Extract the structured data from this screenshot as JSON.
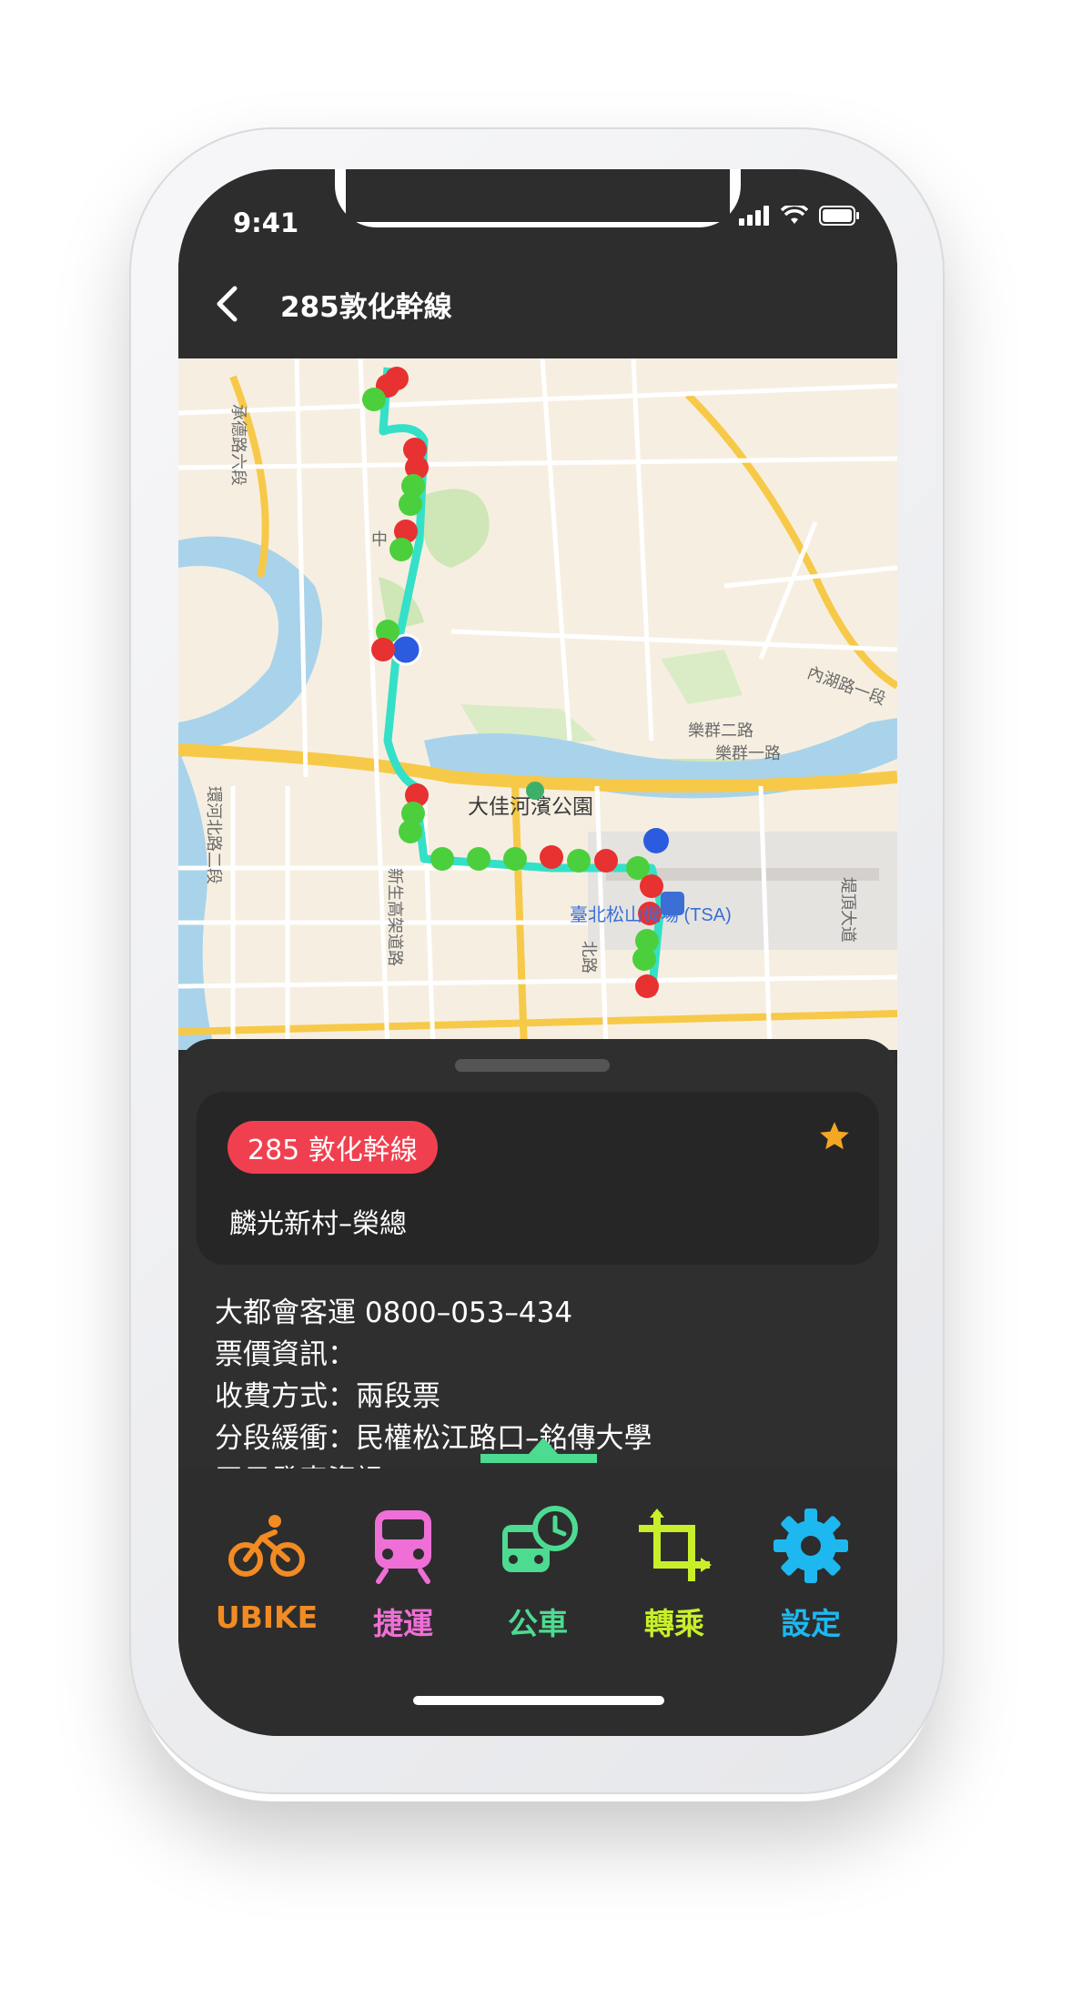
{
  "status_bar": {
    "time": "9:41"
  },
  "nav": {
    "title": "285敦化幹線",
    "back_icon": "chevron-left-icon"
  },
  "map": {
    "labels": {
      "road_chengde": "承德路六段",
      "road_zhong": "中",
      "road_neihu": "內湖路一段",
      "road_leqún2": "樂群二路",
      "road_leqún1": "樂群一路",
      "park": "大佳河濱公園",
      "airport": "臺北松山機場 (TSA)",
      "road_huanhe": "環河北路二段",
      "road_xinsheng": "新生高架道路",
      "road_bei": "北路",
      "road_tidi": "堤頂大道"
    }
  },
  "route_card": {
    "badge": "285 敦化幹線",
    "subtitle": "麟光新村–榮總",
    "favorite_icon": "star-icon",
    "favorite_color": "#f5a623"
  },
  "info": {
    "operator": "大都會客運 0800–053–434",
    "fare": "票價資訊：",
    "payment": "收費方式：兩段票",
    "buffer": "分段緩衝：民權松江路口–銘傳大學",
    "schedule": "平日發車資訊："
  },
  "tabs": [
    {
      "label": "UBIKE",
      "icon": "bicycle-icon",
      "color": "#f28b22"
    },
    {
      "label": "捷運",
      "icon": "metro-train-icon",
      "color": "#ee6fd6"
    },
    {
      "label": "公車",
      "icon": "bus-clock-icon",
      "color": "#4ddb91"
    },
    {
      "label": "轉乘",
      "icon": "transfer-crop-icon",
      "color": "#c8ef2a"
    },
    {
      "label": "設定",
      "icon": "gear-icon",
      "color": "#1eb8f0"
    }
  ]
}
